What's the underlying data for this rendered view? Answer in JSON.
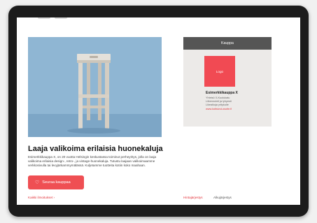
{
  "main": {
    "hero_image_alt": "Puinen jakkara",
    "headline": "Laaja valikoima erilaisia huonekaluja",
    "description": "Esimerkkikauppa X, on 20 vuotta Helsingin keskustassa toiminut perheyritys, jolla on laaja valikoima erilaisia design-, retro-, ja vintage-huonekaluja. Tutustu laajaan valikoimaamme verkkosivulla tai levyjärkammymälässä. Kuljetamme tuotteita kotiin koko maahaan.",
    "follow_button": "Seuraa kauppaa",
    "all_notices_link": "Kaikki ilmoitukset"
  },
  "card": {
    "header": "Kauppa",
    "logo_text": "Logo",
    "shop_name": "Esimerkkikauppa X",
    "lines": [
      "Yhteisö X-Kuolukatu",
      "Liikennointi ja lyhyesti",
      "Likeaikoja yritykulle"
    ],
    "url": "www.kotisivut-osoite.fi"
  },
  "footer": {
    "privacy_link": "Hintajärjestys",
    "terms_link": "Alkujärjestys"
  },
  "colors": {
    "accent": "#ef4f53",
    "card_header": "#555555",
    "hero_bg": "#8fb6d3"
  },
  "icons": {
    "follow": "heart-icon",
    "notices": "chevron-right-icon"
  }
}
